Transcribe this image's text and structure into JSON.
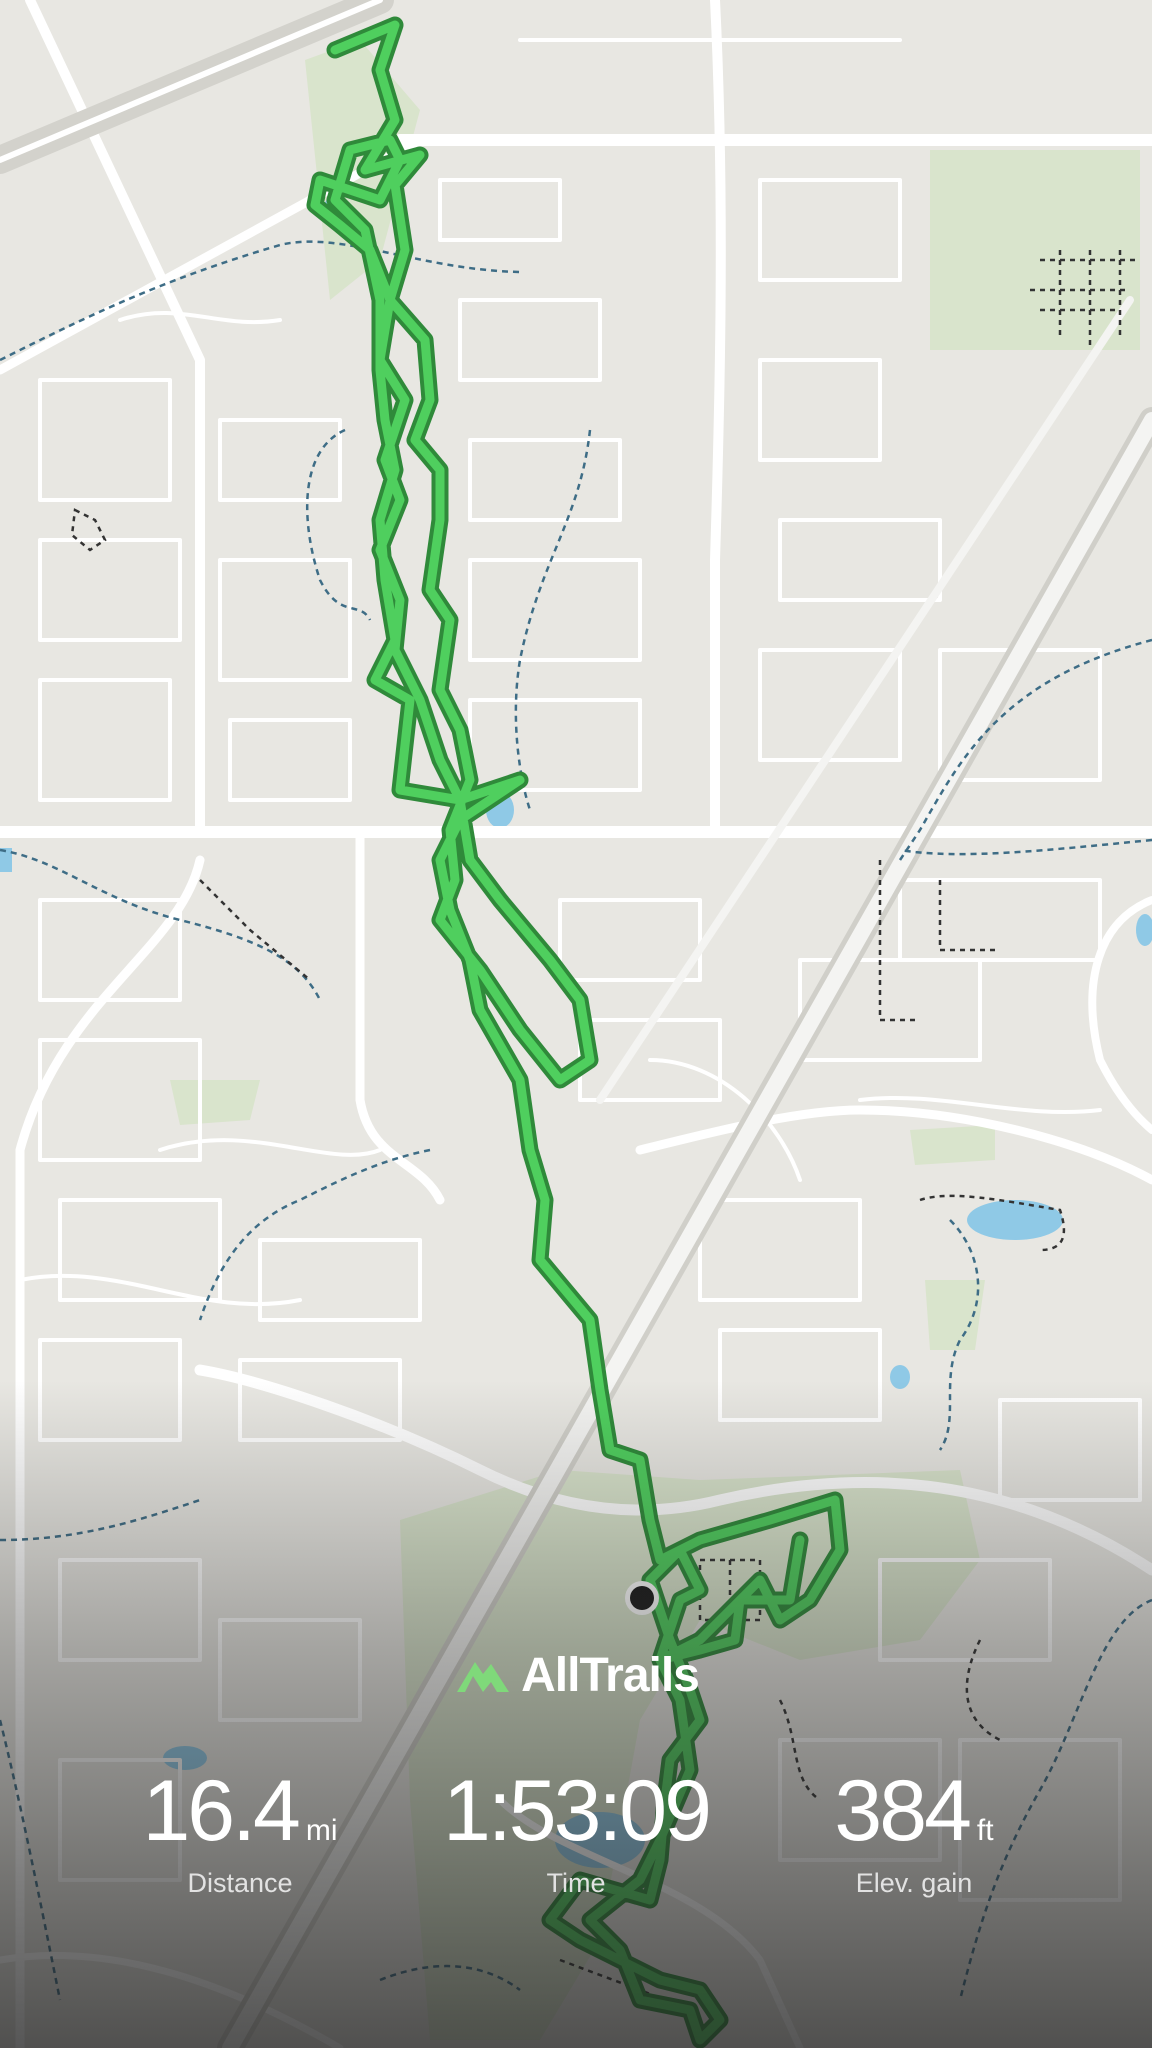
{
  "brand": {
    "name": "AllTrails",
    "logo_icon": "mountain-logo-icon",
    "logo_color": "#7fd97a"
  },
  "stats": {
    "distance": {
      "value": "16.4",
      "unit": "mi",
      "label": "Distance"
    },
    "time": {
      "value": "1:53:09",
      "unit": "",
      "label": "Time"
    },
    "elevation": {
      "value": "384",
      "unit": "ft",
      "label": "Elev. gain"
    }
  },
  "map": {
    "background_color": "#e8e7e2",
    "road_color": "#ffffff",
    "park_color": "#d4e0c4",
    "water_color": "#8fc9e6",
    "track_color": "#4fcf5e",
    "track_outline_color": "#2f8a3a",
    "marker_color": "#1b1b1b"
  }
}
